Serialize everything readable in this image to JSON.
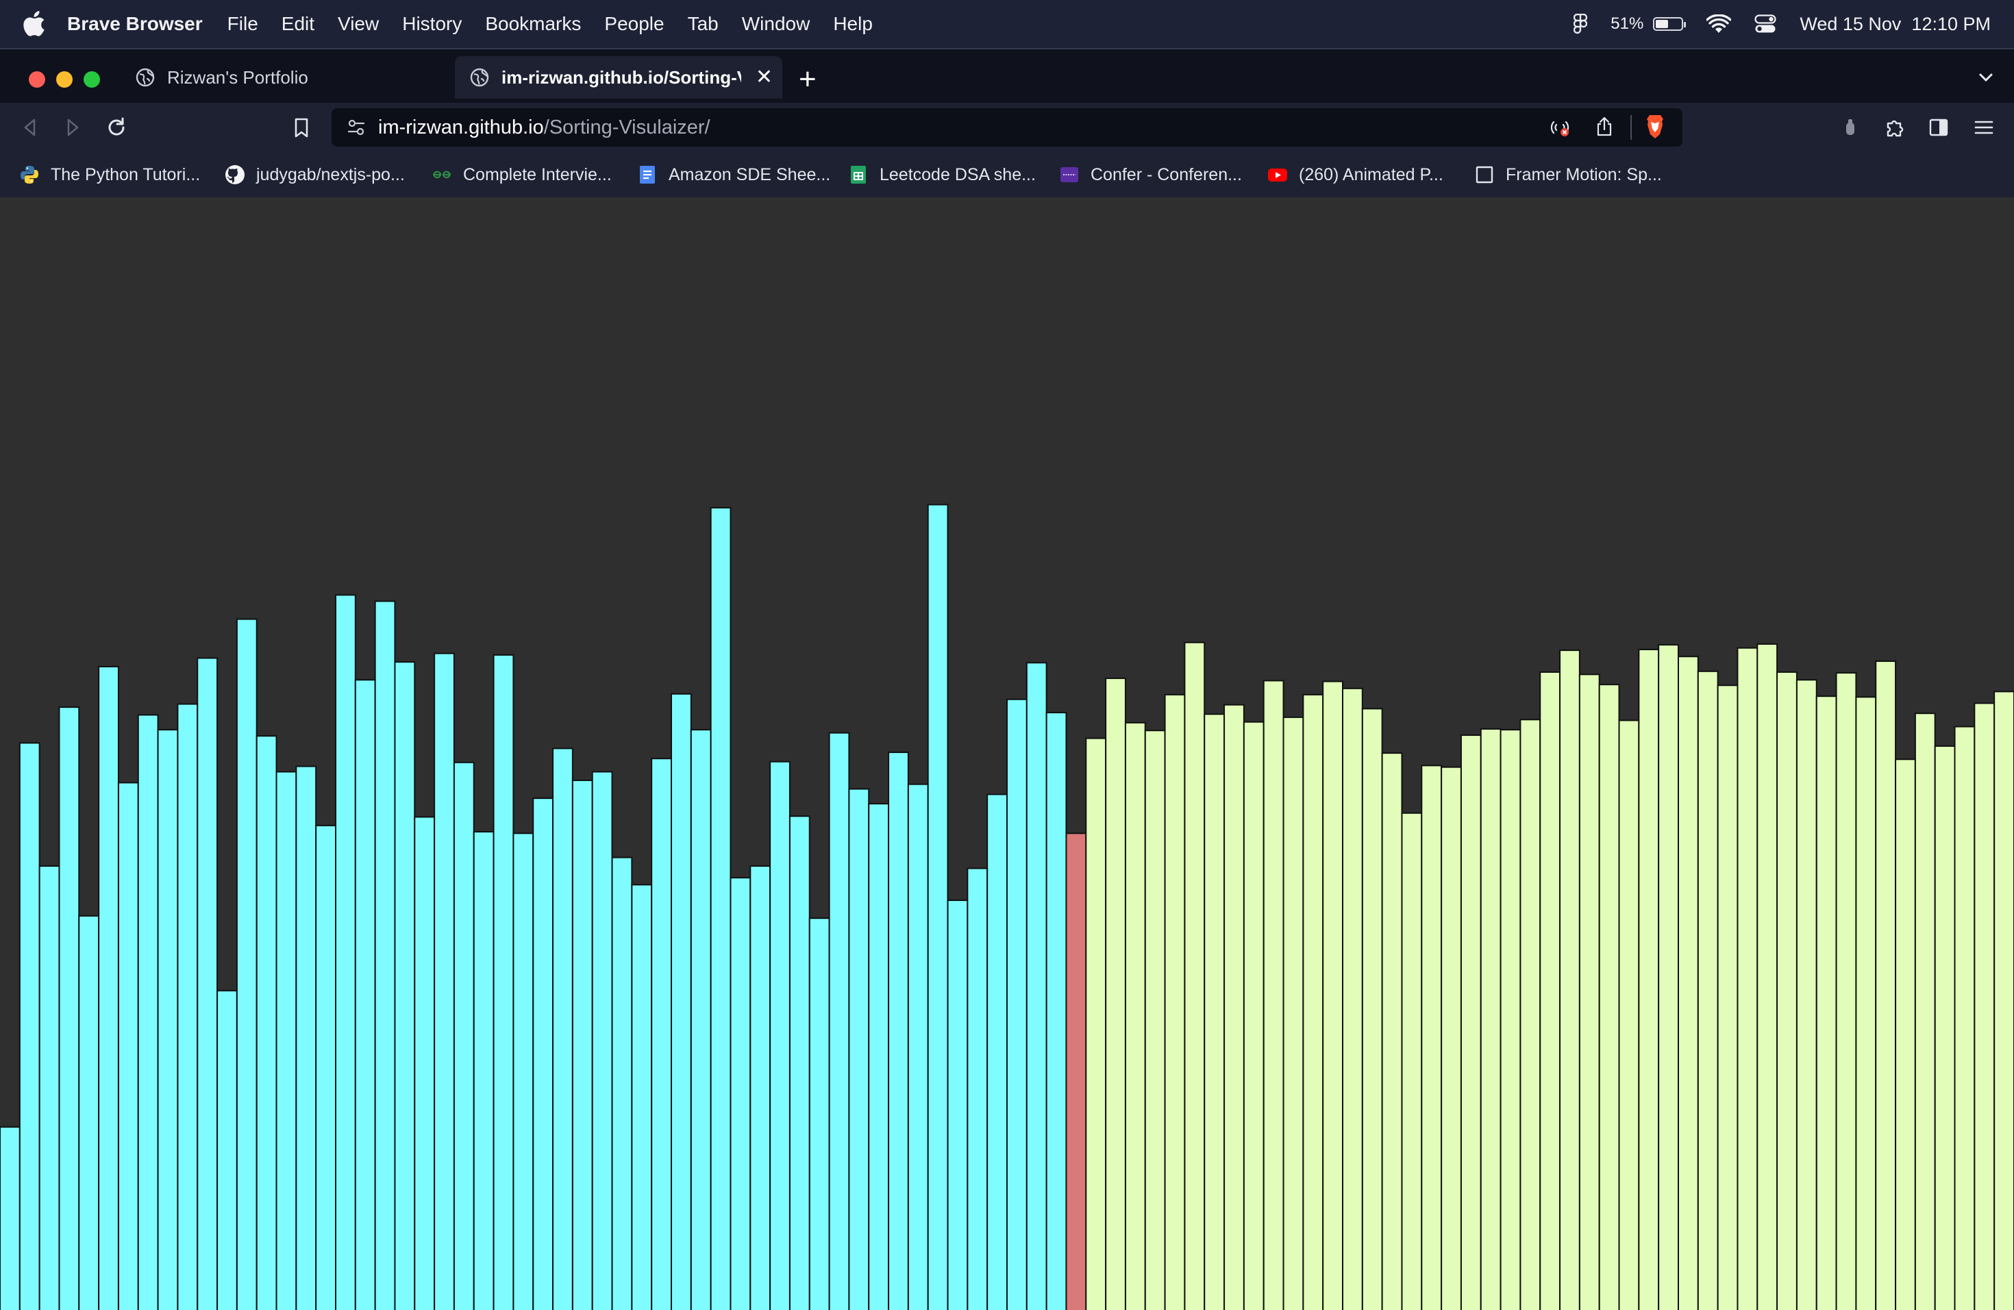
{
  "menubar": {
    "app_name": "Brave Browser",
    "items": [
      "File",
      "Edit",
      "View",
      "History",
      "Bookmarks",
      "People",
      "Tab",
      "Window",
      "Help"
    ],
    "battery_percent": "51%",
    "battery_level": 0.51,
    "datetime": "Wed 15 Nov  12:10 PM"
  },
  "tabs": [
    {
      "title": "Rizwan's Portfolio",
      "active": false
    },
    {
      "title": "im-rizwan.github.io/Sorting-Visulaizer/",
      "active": true
    }
  ],
  "address_bar": {
    "host": "im-rizwan.github.io",
    "path": "/Sorting-Visulaizer/"
  },
  "bookmarks": [
    {
      "label": "The Python Tutori...",
      "icon": "python-icon"
    },
    {
      "label": "judygab/nextjs-po...",
      "icon": "github-icon"
    },
    {
      "label": "Complete Intervie...",
      "icon": "gfg-icon"
    },
    {
      "label": "Amazon SDE Shee...",
      "icon": "docs-icon"
    },
    {
      "label": "Leetcode DSA she...",
      "icon": "sheets-icon"
    },
    {
      "label": "Confer - Conferen...",
      "icon": "colorlib-icon"
    },
    {
      "label": "(260) Animated P...",
      "icon": "youtube-icon"
    },
    {
      "label": "Framer Motion: Sp...",
      "icon": "page-icon"
    }
  ],
  "visualizer": {
    "colors": {
      "unsorted": "#7ffcff",
      "current": "#d97a78",
      "sorted": "#e2fdb9",
      "background": "#2f2f2f"
    },
    "max_value": 1000,
    "current_index": 54,
    "values": [
      235,
      728,
      570,
      774,
      506,
      826,
      677,
      764,
      745,
      778,
      837,
      410,
      887,
      737,
      691,
      698,
      622,
      918,
      809,
      910,
      832,
      633,
      843,
      703,
      614,
      841,
      612,
      657,
      721,
      680,
      691,
      581,
      546,
      708,
      791,
      745,
      1030,
      555,
      570,
      704,
      634,
      503,
      741,
      669,
      650,
      716,
      675,
      1034,
      526,
      567,
      662,
      784,
      831,
      767,
      612,
      734,
      811,
      754,
      744,
      790,
      857,
      765,
      777,
      755,
      808,
      761,
      790,
      807,
      798,
      772,
      715,
      638,
      699,
      697,
      738,
      746,
      745,
      758,
      819,
      847,
      816,
      803,
      757,
      848,
      854,
      839,
      820,
      802,
      850,
      855,
      819,
      809,
      788,
      818,
      787,
      833,
      707,
      766,
      724,
      749,
      779,
      794
    ]
  }
}
